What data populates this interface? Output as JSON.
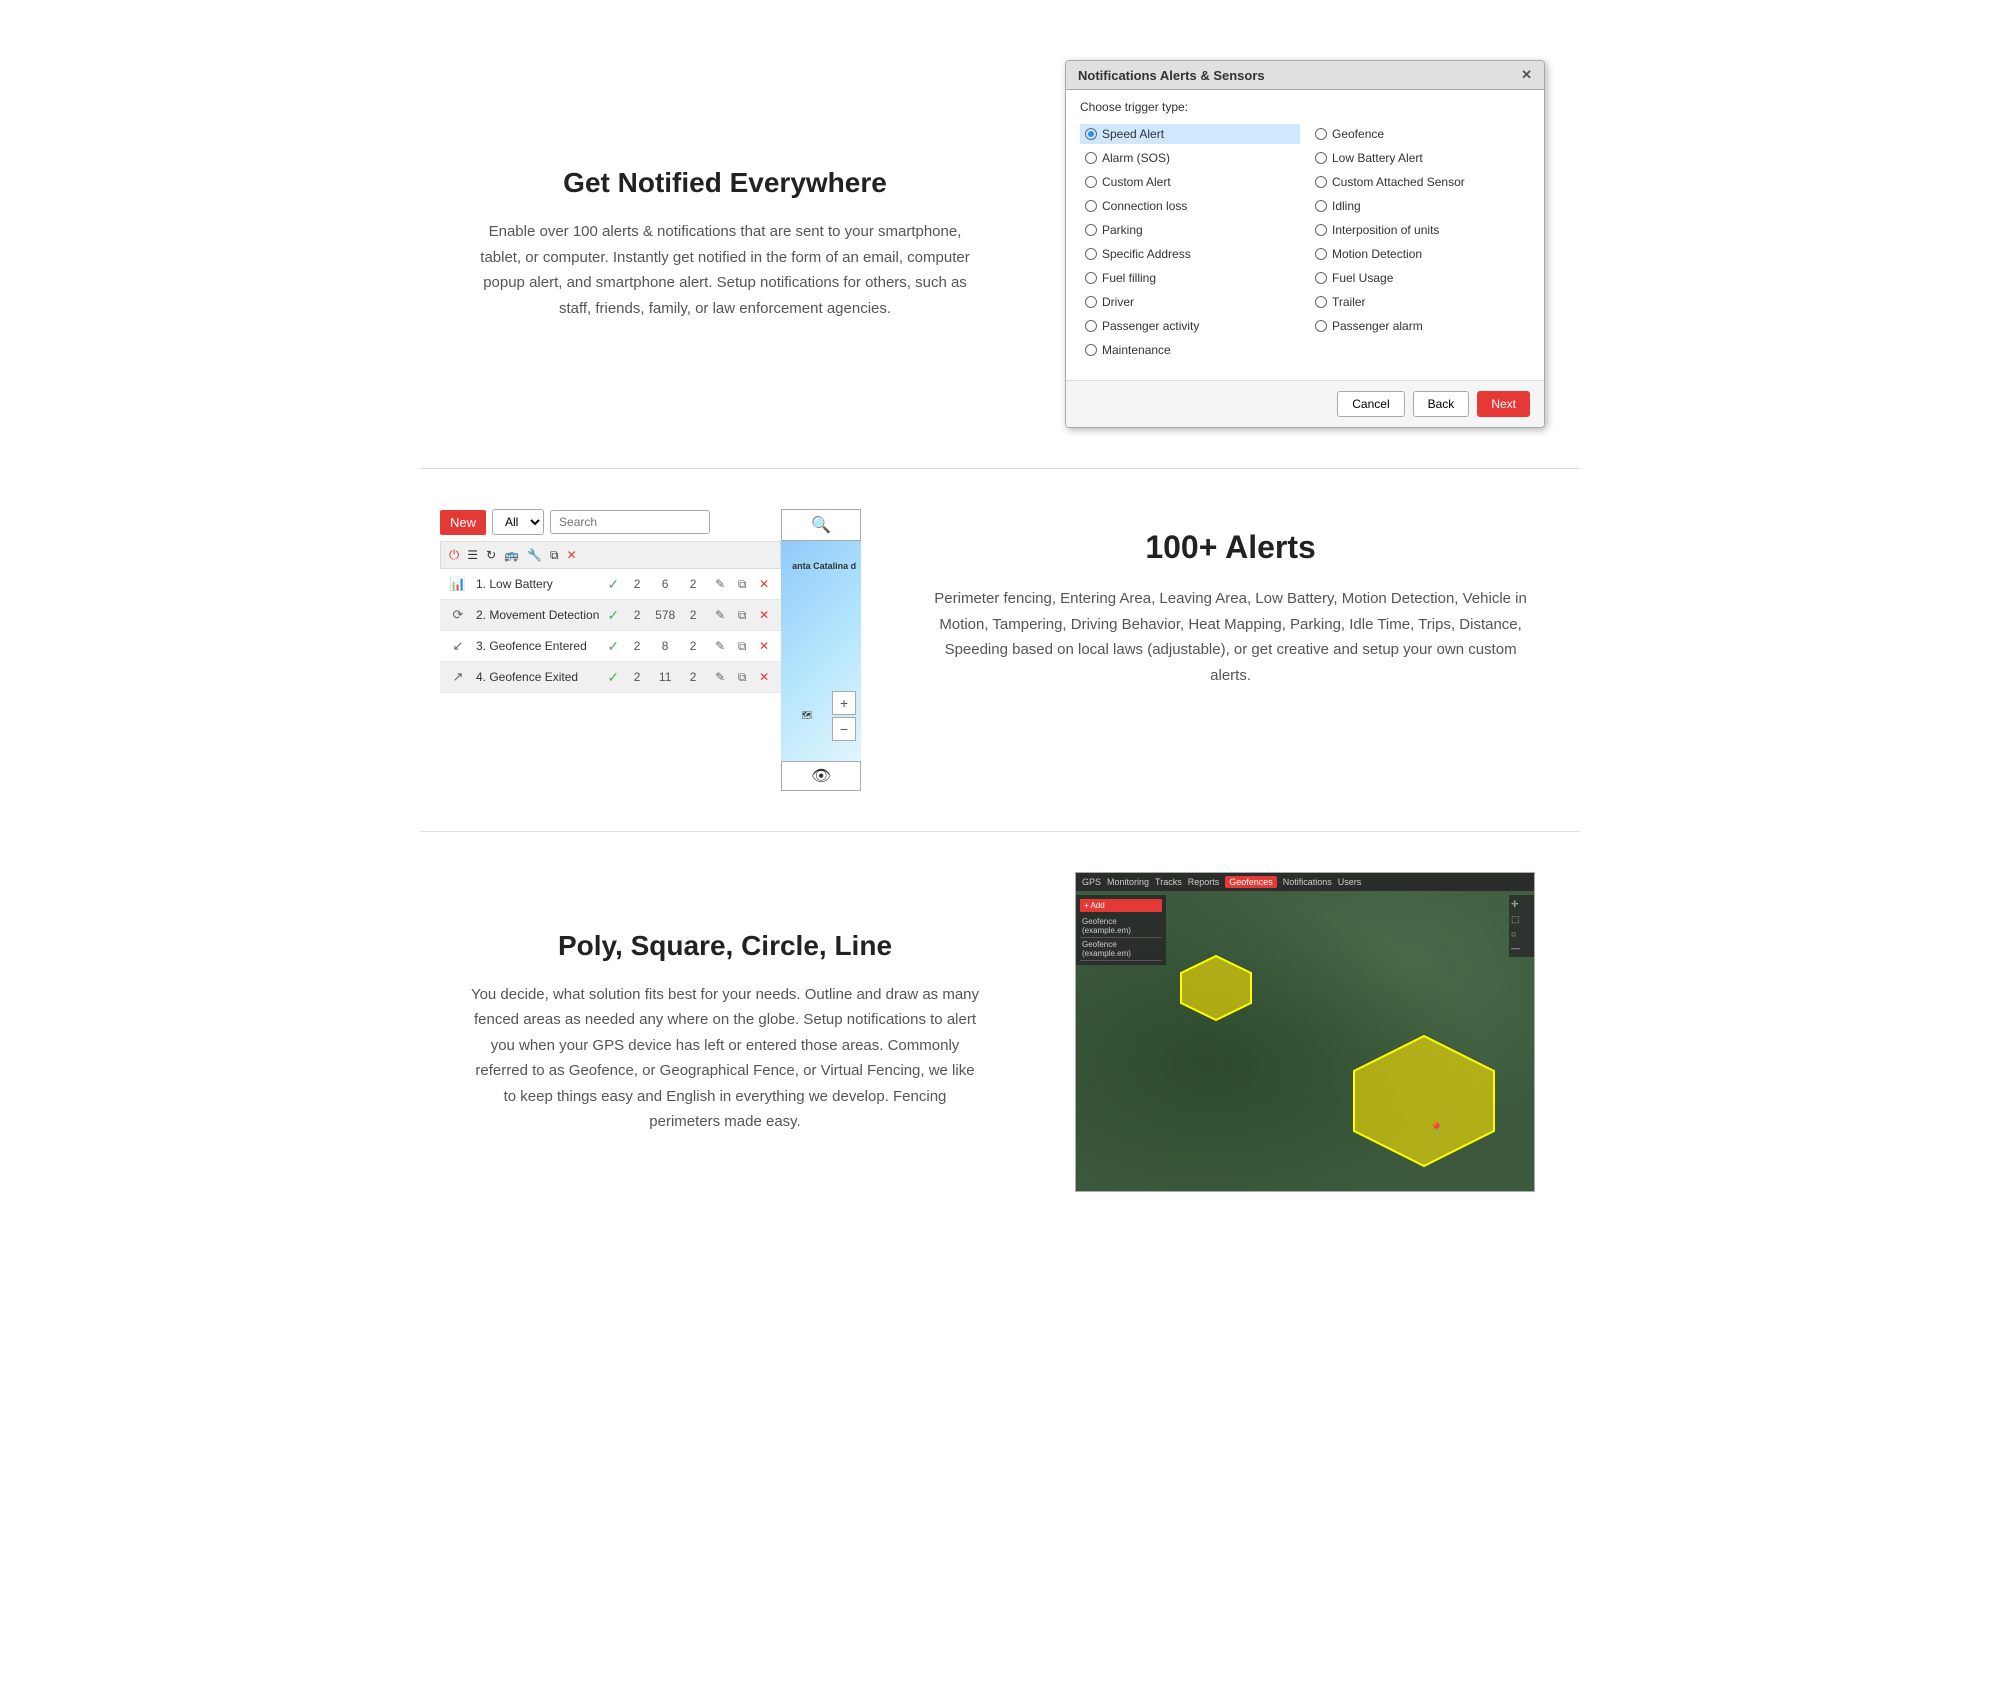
{
  "section1": {
    "title": "Get Notified Everywhere",
    "description": "Enable over 100 alerts & notifications that are sent to your smartphone, tablet, or computer. Instantly get notified in the form of an email, computer popup alert, and smartphone alert. Setup notifications for others, such as staff, friends, family, or law enforcement agencies.",
    "dialog": {
      "title": "Notifications Alerts & Sensors",
      "subtitle": "Choose trigger type:",
      "options_left": [
        {
          "label": "Speed Alert",
          "selected": true
        },
        {
          "label": "Alarm (SOS)",
          "selected": false
        },
        {
          "label": "Custom Alert",
          "selected": false
        },
        {
          "label": "Connection loss",
          "selected": false
        },
        {
          "label": "Parking",
          "selected": false
        },
        {
          "label": "Specific Address",
          "selected": false
        },
        {
          "label": "Fuel filling",
          "selected": false
        },
        {
          "label": "Driver",
          "selected": false
        },
        {
          "label": "Passenger activity",
          "selected": false
        },
        {
          "label": "Maintenance",
          "selected": false
        }
      ],
      "options_right": [
        {
          "label": "Geofence",
          "selected": false
        },
        {
          "label": "Low Battery Alert",
          "selected": false
        },
        {
          "label": "Custom Attached Sensor",
          "selected": false
        },
        {
          "label": "Idling",
          "selected": false
        },
        {
          "label": "Interposition of units",
          "selected": false
        },
        {
          "label": "Motion Detection",
          "selected": false
        },
        {
          "label": "Fuel Usage",
          "selected": false
        },
        {
          "label": "Trailer",
          "selected": false
        },
        {
          "label": "Passenger alarm",
          "selected": false
        }
      ],
      "btn_cancel": "Cancel",
      "btn_back": "Back",
      "btn_next": "Next"
    }
  },
  "section2": {
    "toolbar": {
      "btn_new": "New",
      "dropdown_default": "All",
      "search_placeholder": "Search"
    },
    "alerts": [
      {
        "icon": "bar-chart",
        "name": "1. Low Battery",
        "checked": true,
        "num1": "2",
        "num2": "6",
        "num3": "2"
      },
      {
        "icon": "circle-arrow",
        "name": "2. Movement Detection",
        "checked": true,
        "num1": "2",
        "num2": "578",
        "num3": "2"
      },
      {
        "icon": "geofence-in",
        "name": "3. Geofence Entered",
        "checked": true,
        "num1": "2",
        "num2": "8",
        "num3": "2"
      },
      {
        "icon": "geofence-out",
        "name": "4. Geofence Exited",
        "checked": true,
        "num1": "2",
        "num2": "11",
        "num3": "2"
      }
    ],
    "map_label": "anta Catalina\nd",
    "title": "100+ Alerts",
    "description": "Perimeter fencing, Entering Area, Leaving Area, Low Battery, Motion Detection, Vehicle in Motion, Tampering, Driving Behavior, Heat Mapping, Parking, Idle Time, Trips, Distance, Speeding based on local laws (adjustable), or get creative and setup your own custom alerts."
  },
  "section3": {
    "title": "Poly, Square, Circle, Line",
    "description": "You decide, what solution fits best for your needs. Outline and draw as many fenced areas as needed any where on the globe. Setup notifications to alert you when your GPS device has left or entered those areas. Commonly referred to as Geofence, or Geographical Fence, or Virtual Fencing, we like to keep things easy and English in everything we develop. Fencing perimeters made easy.",
    "map": {
      "sidebar_items": [
        "Geofence (example.em)",
        "Geofence (example.em)"
      ]
    }
  }
}
